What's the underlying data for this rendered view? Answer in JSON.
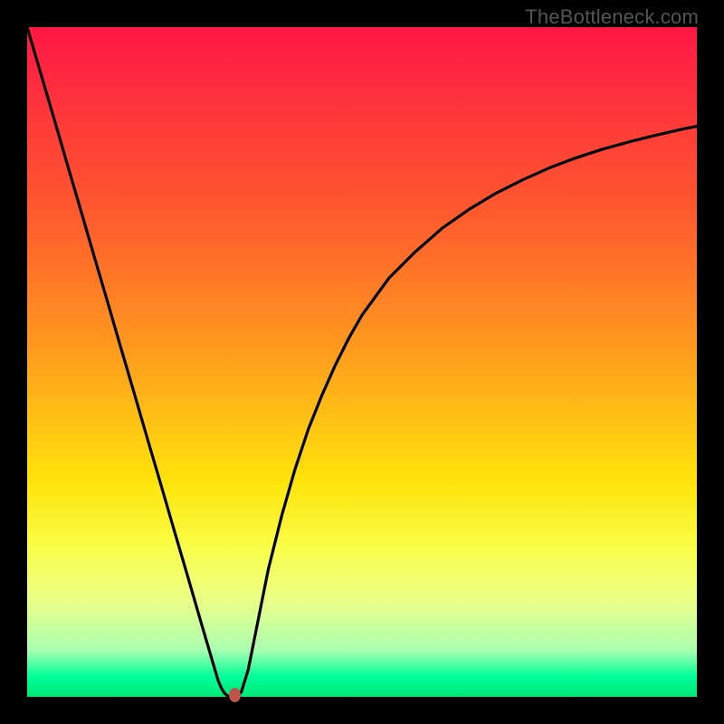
{
  "watermark": "TheBottleneck.com",
  "colors": {
    "background": "#000000",
    "curve": "#000000",
    "marker": "#c0544a",
    "gradient_top": "#ff1744",
    "gradient_bottom": "#00e676"
  },
  "chart_data": {
    "type": "line",
    "title": "",
    "xlabel": "",
    "ylabel": "",
    "xlim": [
      0,
      1
    ],
    "ylim": [
      0,
      1
    ],
    "x": [
      0.0,
      0.02,
      0.04,
      0.06,
      0.08,
      0.1,
      0.12,
      0.14,
      0.16,
      0.18,
      0.2,
      0.22,
      0.24,
      0.26,
      0.28,
      0.285,
      0.29,
      0.295,
      0.3,
      0.305,
      0.31,
      0.315,
      0.32,
      0.33,
      0.34,
      0.36,
      0.38,
      0.4,
      0.42,
      0.44,
      0.46,
      0.48,
      0.5,
      0.54,
      0.58,
      0.62,
      0.66,
      0.7,
      0.74,
      0.78,
      0.82,
      0.86,
      0.9,
      0.94,
      0.98,
      1.0
    ],
    "y": [
      1.0,
      0.932,
      0.864,
      0.795,
      0.727,
      0.658,
      0.59,
      0.521,
      0.453,
      0.384,
      0.316,
      0.247,
      0.179,
      0.11,
      0.042,
      0.025,
      0.013,
      0.005,
      0.001,
      0.0,
      0.0,
      0.001,
      0.008,
      0.04,
      0.09,
      0.19,
      0.27,
      0.34,
      0.4,
      0.45,
      0.495,
      0.535,
      0.57,
      0.625,
      0.665,
      0.7,
      0.728,
      0.752,
      0.772,
      0.79,
      0.805,
      0.818,
      0.829,
      0.839,
      0.848,
      0.852
    ],
    "marker": {
      "x": 0.31,
      "y": 0.0
    },
    "annotations": []
  }
}
